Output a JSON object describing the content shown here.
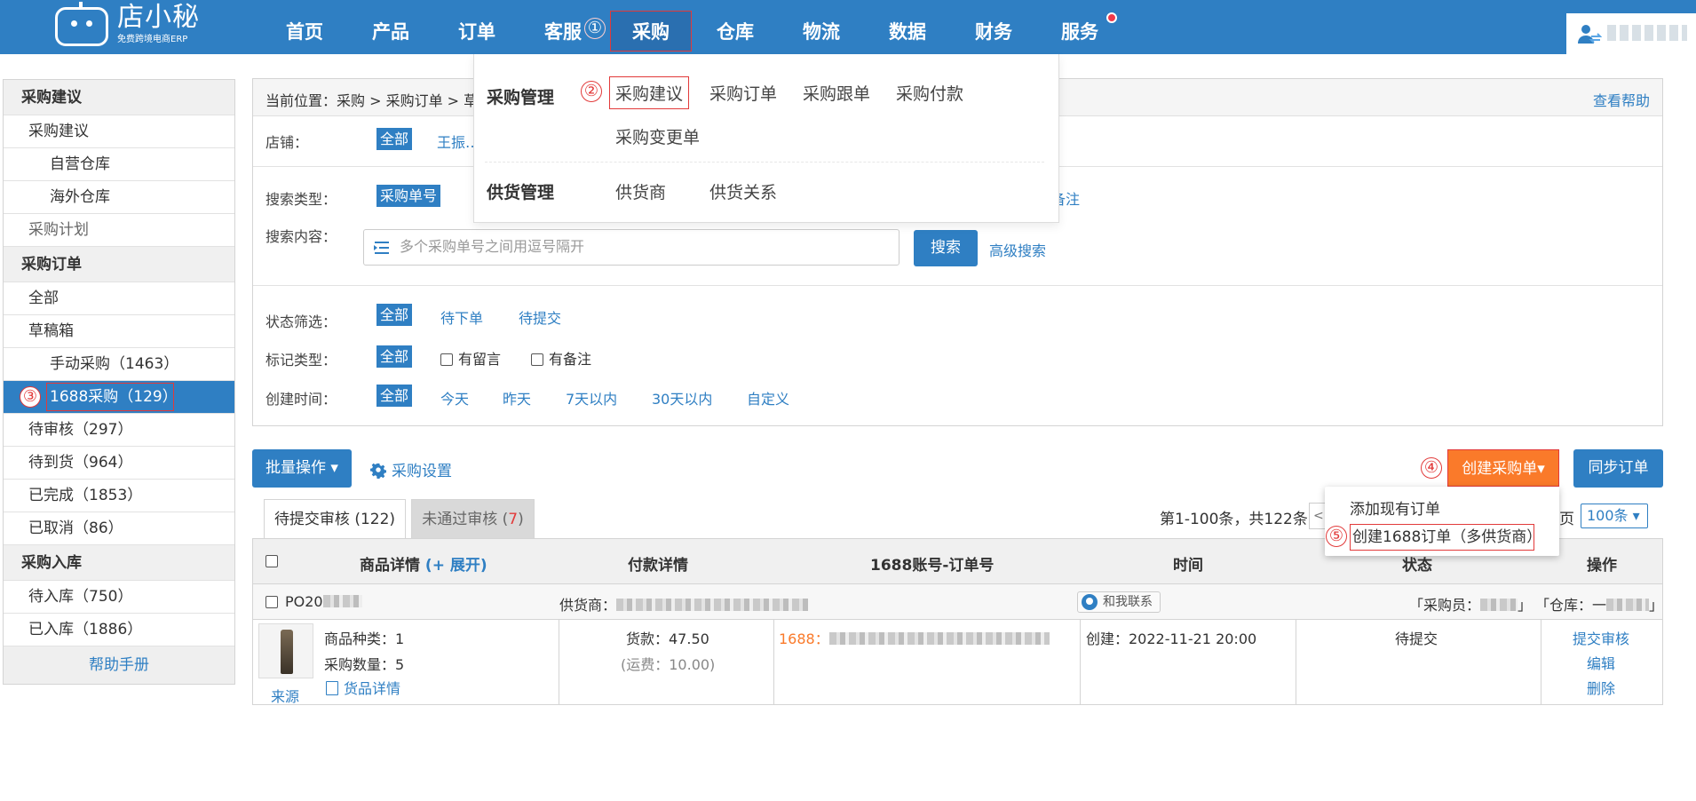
{
  "brand": {
    "name": "店小秘",
    "tagline": "免费跨境电商ERP"
  },
  "nav": {
    "items": [
      "首页",
      "产品",
      "订单",
      "客服",
      "采购",
      "仓库",
      "物流",
      "数据",
      "财务",
      "服务"
    ],
    "active": "采购"
  },
  "markers": [
    "①",
    "②",
    "③",
    "④",
    "⑤"
  ],
  "mega_menu": {
    "groups": [
      {
        "title": "采购管理",
        "items": [
          "采购建议",
          "采购订单",
          "采购跟单",
          "采购付款",
          "采购变更单"
        ]
      },
      {
        "title": "供货管理",
        "items": [
          "供货商",
          "供货关系"
        ]
      }
    ]
  },
  "sidebar": {
    "sections": [
      {
        "title": "采购建议",
        "items": [
          "采购建议",
          "自营仓库",
          "海外仓库",
          "采购计划"
        ]
      },
      {
        "title": "采购订单",
        "items": [
          "全部",
          "草稿箱",
          "手动采购（1463）",
          "1688采购（129）",
          "待审核（297）",
          "待到货（964）",
          "已完成（1853）",
          "已取消（86）"
        ]
      },
      {
        "title": "采购入库",
        "items": [
          "待入库（750）",
          "已入库（1886）"
        ]
      }
    ],
    "active_item": "1688采购（129）",
    "help": "帮助手册"
  },
  "breadcrumb": {
    "label": "当前位置：",
    "path": "采购 > 采购订单 > 草",
    "help": "查看帮助"
  },
  "filters": {
    "shop": {
      "label": "店铺：",
      "selected": "全部",
      "option": "王振…"
    },
    "search_type": {
      "label": "搜索类型：",
      "selected": "采购单号",
      "tail": "备注"
    },
    "search": {
      "label": "搜索内容：",
      "placeholder": "多个采购单号之间用逗号隔开",
      "button": "搜索",
      "advanced": "高级搜索"
    },
    "status": {
      "label": "状态筛选：",
      "selected": "全部",
      "options": [
        "待下单",
        "待提交"
      ]
    },
    "mark": {
      "label": "标记类型：",
      "selected": "全部",
      "options": [
        "有留言",
        "有备注"
      ]
    },
    "created": {
      "label": "创建时间：",
      "selected": "全部",
      "options": [
        "今天",
        "昨天",
        "7天以内",
        "30天以内",
        "自定义"
      ]
    }
  },
  "toolbar": {
    "batch": "批量操作 ▾",
    "settings": "采购设置",
    "create": "创建采购单▾",
    "sync": "同步订单",
    "create_menu": [
      "添加现有订单",
      "创建1688订单（多供货商）"
    ]
  },
  "tabs": [
    {
      "label": "待提交审核 (122)"
    },
    {
      "label_prefix": "未通过审核 (",
      "count": "7",
      "label_suffix": ")"
    }
  ],
  "pager": {
    "summary": "第1-100条，共122条",
    "suffix": "页",
    "page_size": "100条 ▾"
  },
  "table": {
    "headers": [
      "商品详情",
      "(+ 展开)",
      "付款详情",
      "1688账号-订单号",
      "时间",
      "状态",
      "操作"
    ],
    "order": {
      "po_prefix": "PO20",
      "supplier_label": "供货商：",
      "contact": "和我联系",
      "buyer_label": "「采购员：",
      "warehouse_label": "「仓库：一",
      "close_bracket": "」"
    },
    "row": {
      "source": "来源",
      "kinds": "商品种类：1",
      "qty": "采购数量：5",
      "goods_detail": "货品详情",
      "payment": "货款：47.50",
      "shipping": "(运费：10.00)",
      "account_prefix": "1688：",
      "created": "创建：2022-11-21 20:00",
      "status": "待提交",
      "actions": [
        "提交审核",
        "编辑",
        "删除"
      ]
    }
  },
  "colors": {
    "primary": "#2f7fc3",
    "orange": "#fa7a2a",
    "annotation": "#e23a3a"
  }
}
